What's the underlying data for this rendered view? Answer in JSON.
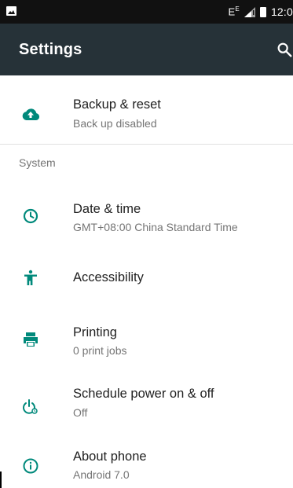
{
  "status_bar": {
    "network": "E",
    "signal_superscript": "E",
    "time": "12:0"
  },
  "app_bar": {
    "title": "Settings",
    "search_icon": "search-icon"
  },
  "items": [
    {
      "title": "Backup & reset",
      "summary": "Back up disabled",
      "icon": "cloud-upload-icon"
    },
    {
      "title": "Date & time",
      "summary": "GMT+08:00 China Standard Time",
      "icon": "clock-icon"
    },
    {
      "title": "Accessibility",
      "summary": "",
      "icon": "accessibility-icon"
    },
    {
      "title": "Printing",
      "summary": "0 print jobs",
      "icon": "printer-icon"
    },
    {
      "title": "Schedule power on & off",
      "summary": "Off",
      "icon": "power-schedule-icon"
    },
    {
      "title": "About phone",
      "summary": "Android 7.0",
      "icon": "info-icon"
    }
  ],
  "sections": {
    "system": "System"
  },
  "colors": {
    "accent": "#00897B",
    "appbar": "#263238",
    "statusbar": "#111111"
  }
}
